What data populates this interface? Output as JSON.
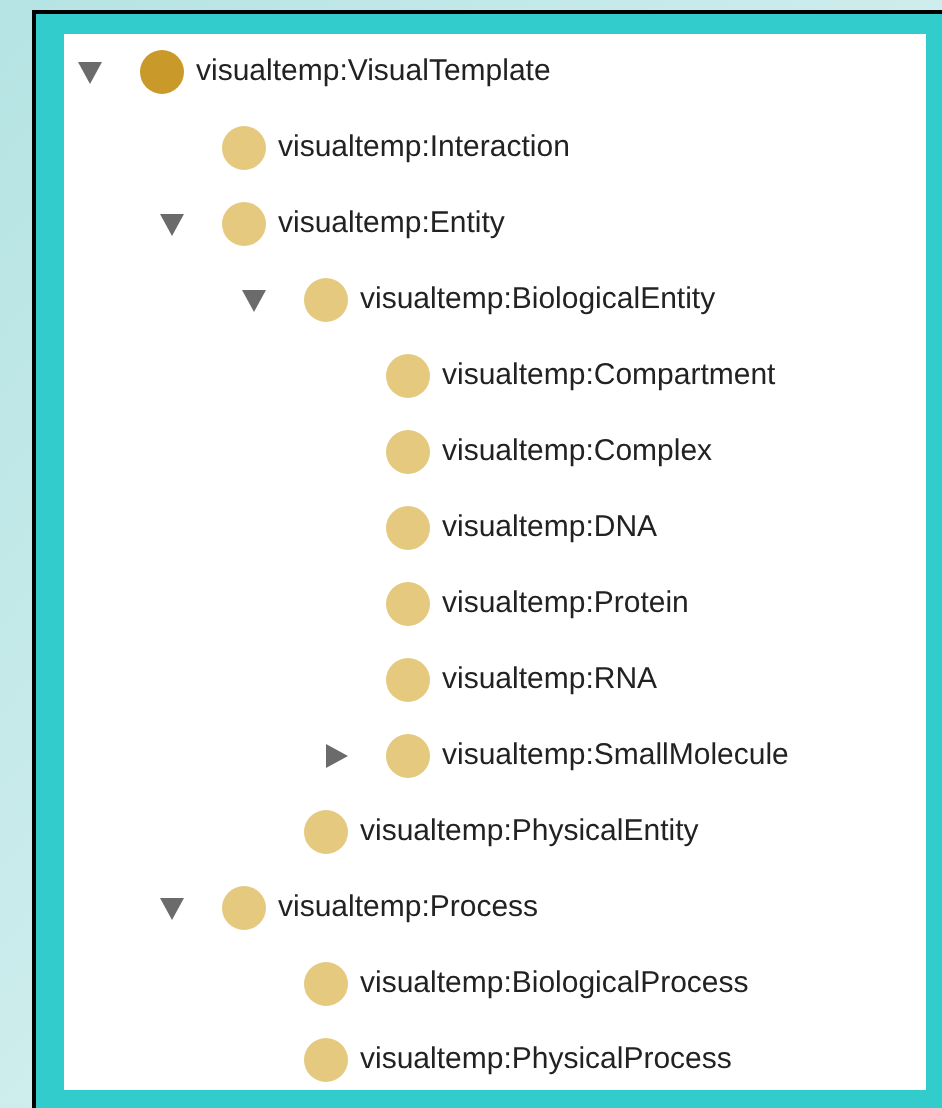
{
  "tree": [
    {
      "label": "visualtemp:VisualTemplate",
      "color": "#c99a2a",
      "expanded": true,
      "children": [
        {
          "label": "visualtemp:Interaction",
          "color": "#e4c97f"
        },
        {
          "label": "visualtemp:Entity",
          "color": "#e4c97f",
          "expanded": true,
          "children": [
            {
              "label": "visualtemp:BiologicalEntity",
              "color": "#e4c97f",
              "expanded": true,
              "children": [
                {
                  "label": "visualtemp:Compartment",
                  "color": "#e4c97f"
                },
                {
                  "label": "visualtemp:Complex",
                  "color": "#e4c97f"
                },
                {
                  "label": "visualtemp:DNA",
                  "color": "#e4c97f"
                },
                {
                  "label": "visualtemp:Protein",
                  "color": "#e4c97f"
                },
                {
                  "label": "visualtemp:RNA",
                  "color": "#e4c97f"
                },
                {
                  "label": "visualtemp:SmallMolecule",
                  "color": "#e4c97f",
                  "expanded": false
                }
              ]
            },
            {
              "label": "visualtemp:PhysicalEntity",
              "color": "#e4c97f"
            }
          ]
        },
        {
          "label": "visualtemp:Process",
          "color": "#e4c97f",
          "expanded": true,
          "children": [
            {
              "label": "visualtemp:BiologicalProcess",
              "color": "#e4c97f"
            },
            {
              "label": "visualtemp:PhysicalProcess",
              "color": "#e4c97f"
            }
          ]
        }
      ]
    }
  ]
}
